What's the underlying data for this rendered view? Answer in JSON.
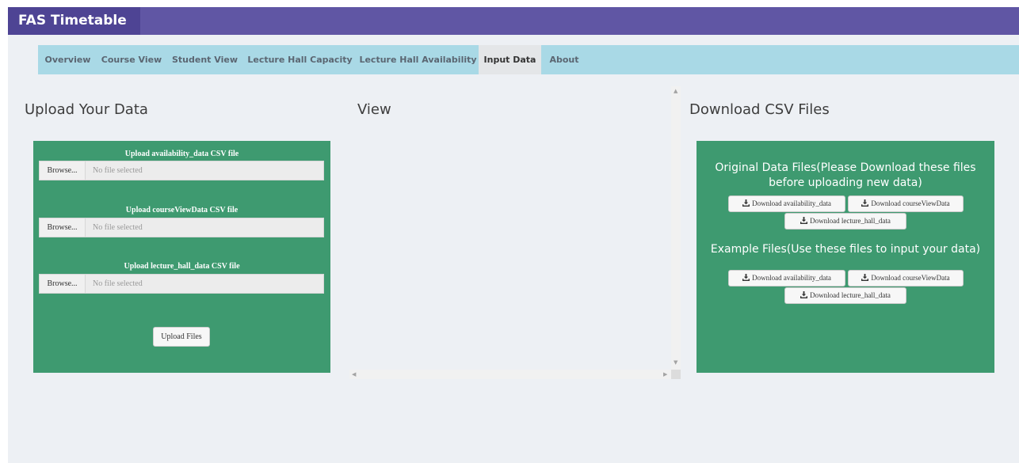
{
  "app": {
    "title": "FAS Timetable"
  },
  "nav": {
    "tabs": [
      {
        "label": "Overview"
      },
      {
        "label": "Course View"
      },
      {
        "label": "Student View"
      },
      {
        "label": "Lecture Hall Capacity"
      },
      {
        "label": "Lecture Hall Availability"
      },
      {
        "label": "Input Data"
      },
      {
        "label": "About"
      }
    ],
    "active": "Input Data"
  },
  "upload": {
    "title": "Upload Your Data",
    "fields": [
      {
        "label": "Upload availability_data CSV file",
        "browse": "Browse...",
        "placeholder": "No file selected"
      },
      {
        "label": "Upload courseViewData CSV file",
        "browse": "Browse...",
        "placeholder": "No file selected"
      },
      {
        "label": "Upload lecture_hall_data CSV file",
        "browse": "Browse...",
        "placeholder": "No file selected"
      }
    ],
    "submit": "Upload Files"
  },
  "view": {
    "title": "View"
  },
  "download": {
    "title": "Download CSV Files",
    "original_heading": "Original Data Files(Please Download these files before uploading new data)",
    "example_heading": "Example Files(Use these files to input your data)",
    "original_buttons": [
      "Download availability_data",
      "Download courseViewData",
      "Download lecture_hall_data"
    ],
    "example_buttons": [
      "Download availability_data",
      "Download courseViewData",
      "Download lecture_hall_data"
    ]
  },
  "colors": {
    "header": "#6056a4",
    "brand": "#4e4494",
    "navbar": "#a9d9e6",
    "panel": "#3e9a70",
    "background": "#edf0f4"
  },
  "icons": {
    "download": "download-icon"
  }
}
